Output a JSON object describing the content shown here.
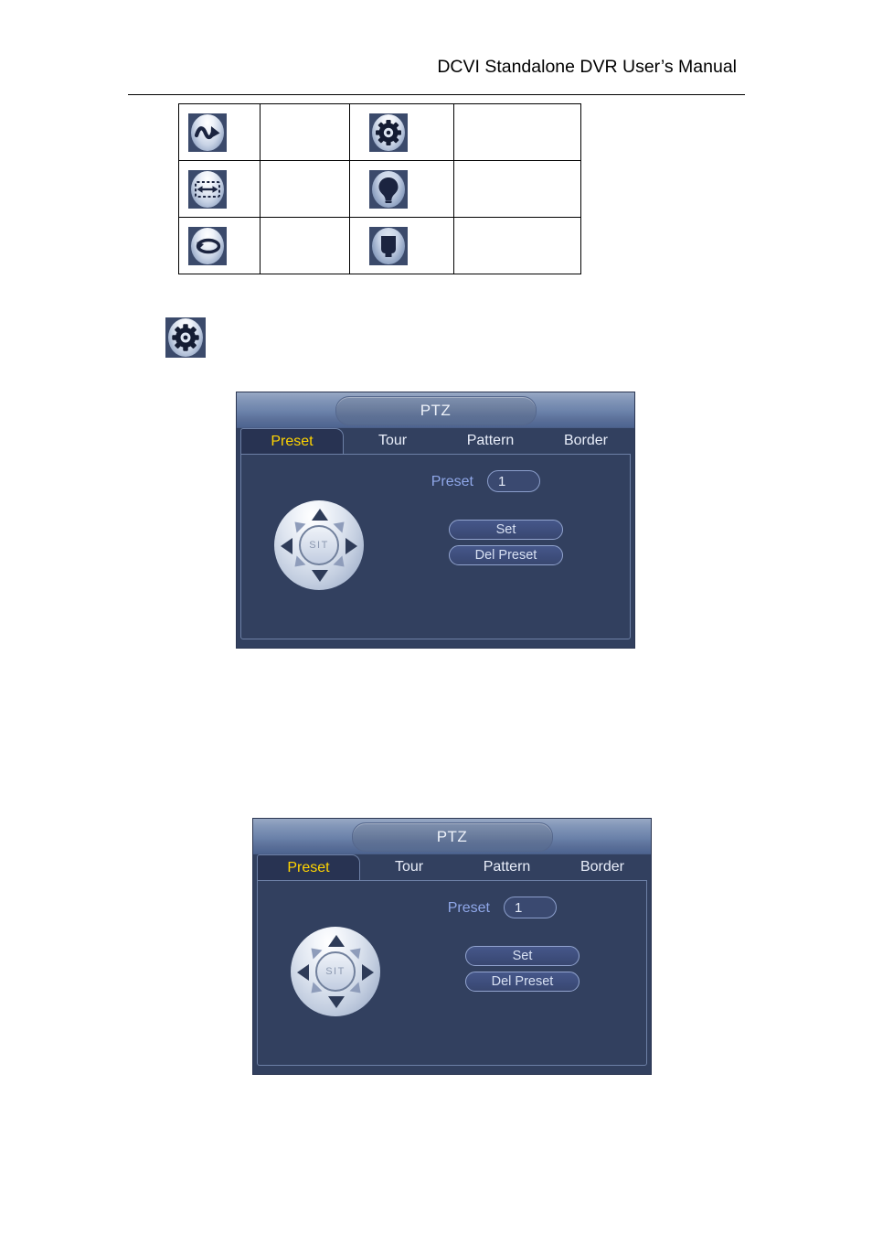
{
  "page": {
    "header_title": "DCVI Standalone DVR User’s Manual"
  },
  "icon_table": {
    "rows": [
      {
        "icon_left": {
          "name": "pattern-wave-icon",
          "label": ""
        },
        "cell_left_text": "",
        "icon_right": {
          "name": "gear-icon",
          "label": ""
        },
        "cell_right_text": ""
      },
      {
        "icon_left": {
          "name": "border-scan-icon",
          "label": ""
        },
        "cell_left_text": "",
        "icon_right": {
          "name": "light-bulb-icon",
          "label": ""
        },
        "cell_right_text": ""
      },
      {
        "icon_left": {
          "name": "auto-pan-rotate-icon",
          "label": ""
        },
        "cell_left_text": "",
        "icon_right": {
          "name": "wiper-icon",
          "label": ""
        },
        "cell_right_text": ""
      }
    ]
  },
  "standalone_icon": {
    "name": "gear-icon"
  },
  "ptz_windows": [
    {
      "title": "PTZ",
      "tabs": [
        {
          "label": "Preset",
          "active": true
        },
        {
          "label": "Tour",
          "active": false
        },
        {
          "label": "Pattern",
          "active": false
        },
        {
          "label": "Border",
          "active": false
        }
      ],
      "preset_label": "Preset",
      "preset_value": "1",
      "preset_placeholder": "1",
      "set_button": "Set",
      "del_preset_button": "Del Preset",
      "dpad_center_label": "SIT"
    },
    {
      "title": "PTZ",
      "tabs": [
        {
          "label": "Preset",
          "active": true
        },
        {
          "label": "Tour",
          "active": false
        },
        {
          "label": "Pattern",
          "active": false
        },
        {
          "label": "Border",
          "active": false
        }
      ],
      "preset_label": "Preset",
      "preset_value": "1",
      "preset_placeholder": "1",
      "set_button": "Set",
      "del_preset_button": "Del Preset",
      "dpad_center_label": "SIT"
    }
  ],
  "colors": {
    "window_bg": "#32405f",
    "tab_active_text": "#ffd400",
    "tab_text": "#e9eefa",
    "label_blue": "#8fa7e8",
    "titlebar_top": "#97a8c4",
    "titlebar_bottom": "#4d6490",
    "border_light": "#6d80a6",
    "page_bg": "#ffffff",
    "text_black": "#000000"
  }
}
